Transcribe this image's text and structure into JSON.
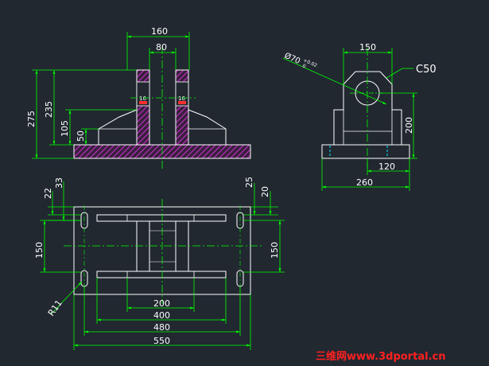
{
  "colors": {
    "background": "#212830",
    "outline": "#ffffff",
    "dimension": "#00ff00",
    "centerline": "#00ff00",
    "hatch": "#cc33cc",
    "hidden": "#00e0ff",
    "mark": "#ff3030",
    "watermark": "#ff2020"
  },
  "front_view": {
    "dims": {
      "width_160": "160",
      "width_80": "80",
      "height_275": "275",
      "height_235": "235",
      "height_105": "105",
      "height_50": "50",
      "label_left": "16",
      "label_right": "16"
    }
  },
  "side_view": {
    "dims": {
      "width_150": "150",
      "bore": "Ø70",
      "tol_upper": "+0.02",
      "tol_lower": "0",
      "chamfer": "C50",
      "height_200": "200",
      "width_120": "120",
      "width_260": "260"
    }
  },
  "top_view": {
    "dims": {
      "left_22": "22",
      "left_33": "33",
      "right_25": "25",
      "right_20": "20",
      "left_150": "150",
      "right_150": "150",
      "radius": "R11",
      "w_200": "200",
      "w_400": "400",
      "w_480": "480",
      "w_550": "550"
    }
  },
  "watermark": {
    "text": "三维网www.3dportal.cn"
  }
}
